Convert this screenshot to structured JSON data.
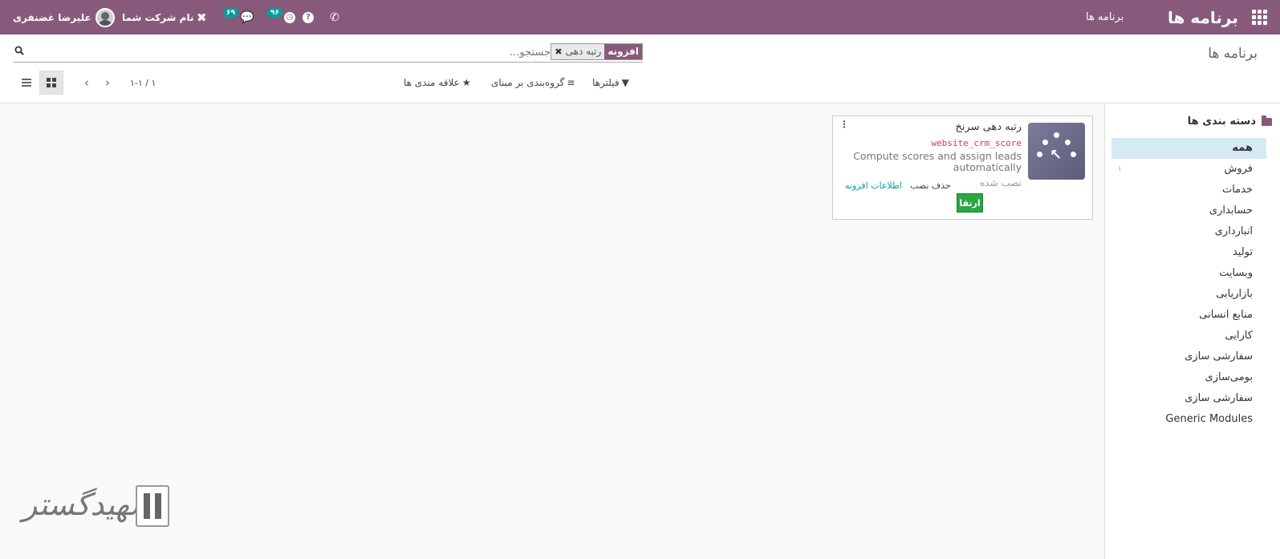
{
  "navbar": {
    "brand": "برنامه ها",
    "menu_apps": "برنامه ها",
    "user_name": "علیرضا غضنفری",
    "company": "نام شرکت شما",
    "messages_count": "۶۹",
    "activities_count": "۹۶"
  },
  "control_panel": {
    "breadcrumb": "برنامه ها",
    "search_placeholder": "جستجو...",
    "facet_label": "افزونه",
    "facet_value": "رتبه دهی",
    "filters_label": "فیلترها",
    "groupby_label": "گروه‌بندی بر مبنای",
    "favorites_label": "علاقه مندی ها",
    "pager": "۱-۱ / ۱"
  },
  "side_panel": {
    "header": "دسته بندی ها",
    "items": [
      {
        "label": "همه",
        "count": ""
      },
      {
        "label": "فروش",
        "count": "۱"
      },
      {
        "label": "خدمات",
        "count": ""
      },
      {
        "label": "حسابداری",
        "count": ""
      },
      {
        "label": "انبارداری",
        "count": ""
      },
      {
        "label": "تولید",
        "count": ""
      },
      {
        "label": "وبسایت",
        "count": ""
      },
      {
        "label": "بازاریابی",
        "count": ""
      },
      {
        "label": "منابع انسانی",
        "count": ""
      },
      {
        "label": "کارایی",
        "count": ""
      },
      {
        "label": "سفارشی سازی",
        "count": ""
      },
      {
        "label": "بومی‌سازی",
        "count": ""
      },
      {
        "label": "سفارشی سازی",
        "count": ""
      },
      {
        "label": "Generic Modules",
        "count": ""
      }
    ]
  },
  "card": {
    "title": "رتبه دهی سرنخ",
    "technical_name": "website_crm_score",
    "description": "Compute scores and assign leads automatically",
    "status": "نصب شده",
    "uninstall_label": "حذف نصب",
    "info_label": "اطلاعات افزونه",
    "upgrade_label": "ارتقا"
  },
  "colors": {
    "brand": "#875a7b",
    "badge": "#00a09d",
    "upgrade": "#28a745",
    "active_category": "#d6eaf5"
  }
}
